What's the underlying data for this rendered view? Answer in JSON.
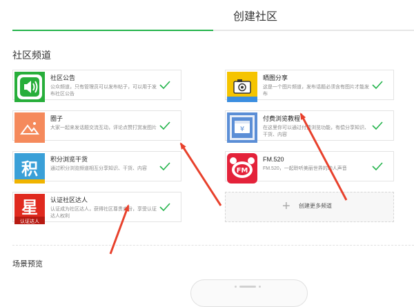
{
  "header": {
    "title": "创建社区",
    "progress_fraction": 0.5
  },
  "section": {
    "title": "社区频道"
  },
  "channels": [
    {
      "name": "社区公告",
      "desc": "公众频道，只有管理员可以发布帖子，可以用于发布社区公告",
      "icon": "speaker-icon",
      "color": "#27ae3a",
      "checked": true
    },
    {
      "name": "晒图分享",
      "desc": "这是一个图片频道，发布话题必须含有图片才能发布",
      "icon": "camera-icon",
      "color": "#f5c400",
      "checked": true
    },
    {
      "name": "圈子",
      "desc": "大家一起来发话题交流互动，评论点赞打赏发图片",
      "icon": "mountain-picture-icon",
      "color": "#f58a5c",
      "checked": true
    },
    {
      "name": "付费浏览教程",
      "desc": "在这里你可以通过付费浏览功能，有偿分享知识、干货、内容",
      "icon": "yen-monitor-icon",
      "color": "#5b8ed6",
      "checked": true
    },
    {
      "name": "积分浏览干货",
      "desc": "通过积分浏览频道相互分享知识、干货、内容",
      "icon": "points-shop-icon",
      "color": "#3aa0d8",
      "checked": true
    },
    {
      "name": "FM.520",
      "desc": "FM.520，一起聆听美丽世界的动人声音",
      "icon": "fm-radio-icon",
      "color": "#e4223a",
      "checked": true
    },
    {
      "name": "认证社区达人",
      "desc": "认证成为社区达人，获得社区尊贵身份，享受认证达人权利",
      "icon": "star-badge-icon",
      "color": "#e02a1f",
      "checked": true
    }
  ],
  "icon_text": {
    "fm": "FM",
    "star_char": "星",
    "star_sub": "认证达人",
    "yen": "¥",
    "points_char": "积"
  },
  "add_channel": {
    "label": "创建更多频道",
    "icon": "plus-icon"
  },
  "preview": {
    "title": "场景预览"
  },
  "colors": {
    "accent": "#22b34a",
    "annotation": "#e8412c"
  }
}
